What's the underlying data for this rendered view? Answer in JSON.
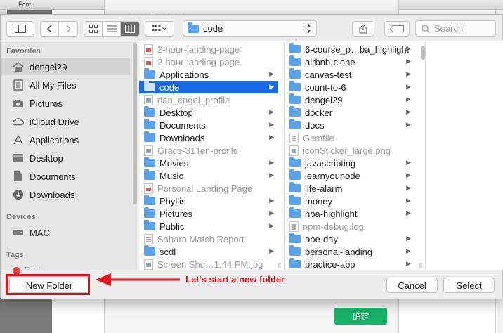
{
  "background_app": {
    "menu_title": "Font",
    "confirm_button": "确定",
    "ghost_text": "·· ··· · ·· · ·"
  },
  "toolbar": {
    "path_popup_value": "code",
    "search_placeholder": "Search"
  },
  "sidebar": {
    "favorites_heading": "Favorites",
    "favorites": [
      {
        "label": "dengel29",
        "icon": "home-icon",
        "selected": true
      },
      {
        "label": "All My Files",
        "icon": "files-icon"
      },
      {
        "label": "Pictures",
        "icon": "camera-icon"
      },
      {
        "label": "iCloud Drive",
        "icon": "cloud-icon"
      },
      {
        "label": "Applications",
        "icon": "applications-icon"
      },
      {
        "label": "Desktop",
        "icon": "desktop-icon"
      },
      {
        "label": "Documents",
        "icon": "document-icon"
      },
      {
        "label": "Downloads",
        "icon": "download-icon"
      }
    ],
    "devices_heading": "Devices",
    "devices": [
      {
        "label": "MAC",
        "icon": "drive-icon"
      }
    ],
    "tags_heading": "Tags",
    "tags": [
      {
        "label": "Red",
        "color": "#e24a4a"
      }
    ]
  },
  "column1": [
    {
      "label": "2-hour-landing-page",
      "type": "pdf",
      "dim": true
    },
    {
      "label": "2-hour-landing-page",
      "type": "pdf",
      "dim": true
    },
    {
      "label": "Applications",
      "type": "folder",
      "chevron": true
    },
    {
      "label": "code",
      "type": "folder",
      "chevron": true,
      "selected": true
    },
    {
      "label": "dan_engel_profile",
      "type": "img",
      "dim": true
    },
    {
      "label": "Desktop",
      "type": "folder",
      "chevron": true
    },
    {
      "label": "Documents",
      "type": "folder",
      "chevron": true
    },
    {
      "label": "Downloads",
      "type": "folder",
      "chevron": true
    },
    {
      "label": "Grace-31Ten-profile",
      "type": "img",
      "dim": true
    },
    {
      "label": "Movies",
      "type": "folder",
      "chevron": true
    },
    {
      "label": "Music",
      "type": "folder",
      "chevron": true
    },
    {
      "label": "Personal Landing Page",
      "type": "pdf",
      "dim": true
    },
    {
      "label": "Phyllis",
      "type": "folder",
      "chevron": true
    },
    {
      "label": "Pictures",
      "type": "folder",
      "chevron": true
    },
    {
      "label": "Public",
      "type": "folder",
      "chevron": true
    },
    {
      "label": "Sahara Match Report",
      "type": "page",
      "dim": true
    },
    {
      "label": "scdl",
      "type": "folder",
      "chevron": true
    },
    {
      "label": "Screen Sho…1.44 PM.jpg",
      "type": "img",
      "dim": true
    }
  ],
  "column2": [
    {
      "label": "6-course_p…ba_highlight",
      "type": "folder",
      "chevron": true
    },
    {
      "label": "airbnb-clone",
      "type": "folder",
      "chevron": true
    },
    {
      "label": "canvas-test",
      "type": "folder",
      "chevron": true
    },
    {
      "label": "count-to-6",
      "type": "folder",
      "chevron": true
    },
    {
      "label": "dengel29",
      "type": "folder",
      "chevron": true
    },
    {
      "label": "docker",
      "type": "folder",
      "chevron": true
    },
    {
      "label": "docs",
      "type": "folder",
      "chevron": true
    },
    {
      "label": "Gemfile",
      "type": "page",
      "dim": true
    },
    {
      "label": "iconSticker_large.png",
      "type": "img",
      "dim": true
    },
    {
      "label": "javascripting",
      "type": "folder",
      "chevron": true
    },
    {
      "label": "learnyounode",
      "type": "folder",
      "chevron": true
    },
    {
      "label": "life-alarm",
      "type": "folder",
      "chevron": true
    },
    {
      "label": "money",
      "type": "folder",
      "chevron": true
    },
    {
      "label": "nba-highlight",
      "type": "folder",
      "chevron": true
    },
    {
      "label": "npm-debug.log",
      "type": "page",
      "dim": true
    },
    {
      "label": "one-day",
      "type": "folder",
      "chevron": true
    },
    {
      "label": "personal-landing",
      "type": "folder",
      "chevron": true
    },
    {
      "label": "practice-app",
      "type": "folder",
      "chevron": true
    }
  ],
  "bottom": {
    "new_folder": "New Folder",
    "cancel": "Cancel",
    "select": "Select"
  },
  "annotation": {
    "text": "Let’s start a new folder",
    "color": "#e8101a"
  }
}
